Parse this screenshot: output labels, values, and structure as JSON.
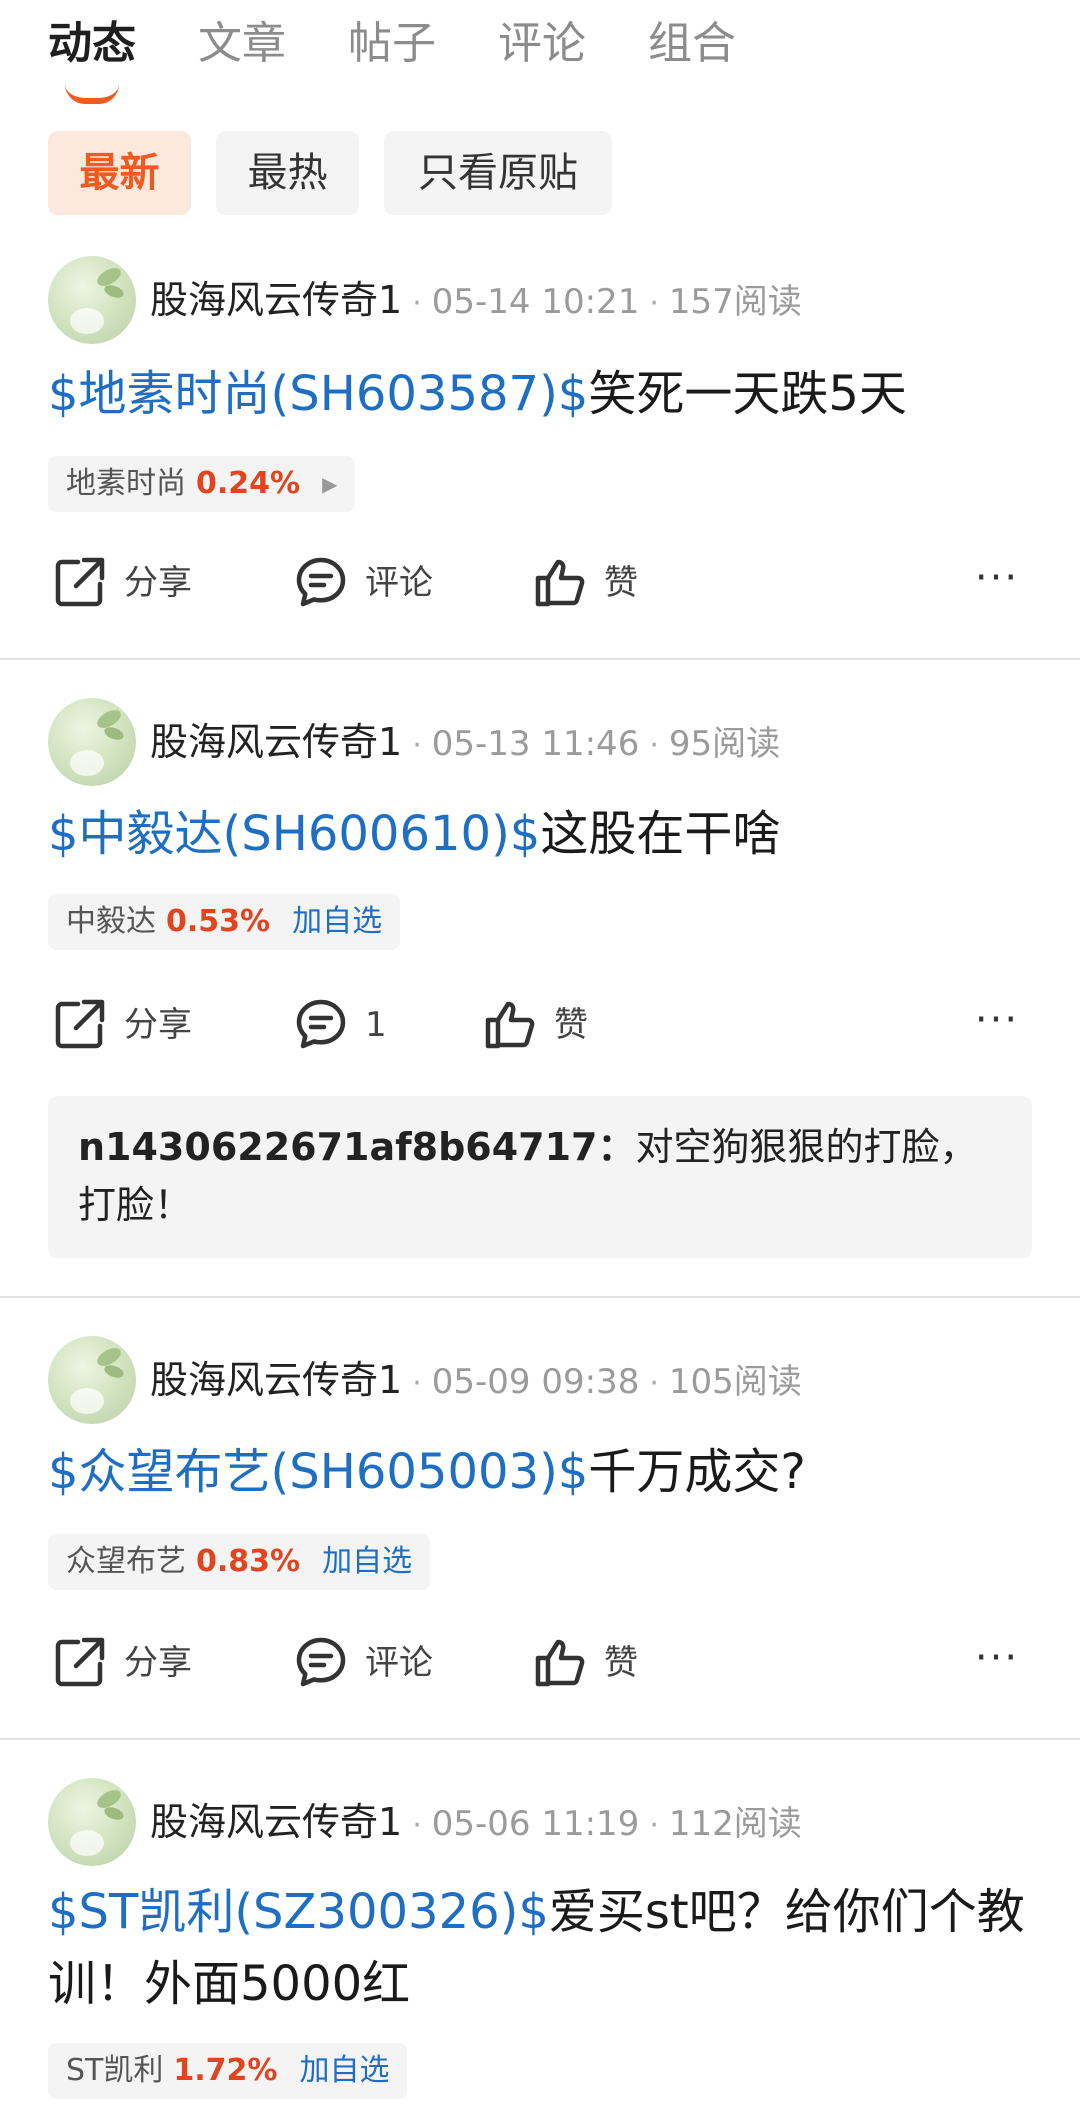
{
  "tabs": [
    {
      "label": "动态",
      "active": true
    },
    {
      "label": "文章",
      "active": false
    },
    {
      "label": "帖子",
      "active": false
    },
    {
      "label": "评论",
      "active": false
    },
    {
      "label": "组合",
      "active": false
    }
  ],
  "filters": [
    {
      "label": "最新",
      "active": true
    },
    {
      "label": "最热",
      "active": false
    },
    {
      "label": "只看原贴",
      "active": false
    }
  ],
  "posts": [
    {
      "author": "股海风云传奇1",
      "time": "05-14 10:21",
      "reads": "157阅读",
      "stock_tag": "$地素时尚(SH603587)$",
      "text": "笑死一天跌5天",
      "quote": {
        "name": "地素时尚",
        "change": "0.24%",
        "arrow": "▶"
      },
      "actions": {
        "share": "分享",
        "comment": "评论",
        "like": "赞",
        "more": "···"
      }
    },
    {
      "author": "股海风云传奇1",
      "time": "05-13 11:46",
      "reads": "95阅读",
      "stock_tag": "$中毅达(SH600610)$",
      "text": "这股在干啥",
      "quote": {
        "name": "中毅达",
        "change": "0.53%",
        "add": "加自选"
      },
      "actions": {
        "share": "分享",
        "comment": "1",
        "like": "赞",
        "more": "···"
      },
      "comment_preview": {
        "user": "n1430622671af8b64717：",
        "text": "对空狗狠狠的打脸，打脸！"
      }
    },
    {
      "author": "股海风云传奇1",
      "time": "05-09 09:38",
      "reads": "105阅读",
      "stock_tag": "$众望布艺(SH605003)$",
      "text": "千万成交?",
      "quote": {
        "name": "众望布艺",
        "change": "0.83%",
        "add": "加自选"
      },
      "actions": {
        "share": "分享",
        "comment": "评论",
        "like": "赞",
        "more": "···"
      }
    },
    {
      "author": "股海风云传奇1",
      "time": "05-06 11:19",
      "reads": "112阅读",
      "stock_tag": "$ST凯利(SZ300326)$",
      "text": "爱买st吧？给你们个教训！外面5000红",
      "quote": {
        "name": "ST凯利",
        "change": "1.72%",
        "add": "加自选"
      }
    }
  ],
  "separator": "·",
  "colors": {
    "accent": "#f15a22",
    "link": "#1e6fc4",
    "up": "#e2451d"
  }
}
